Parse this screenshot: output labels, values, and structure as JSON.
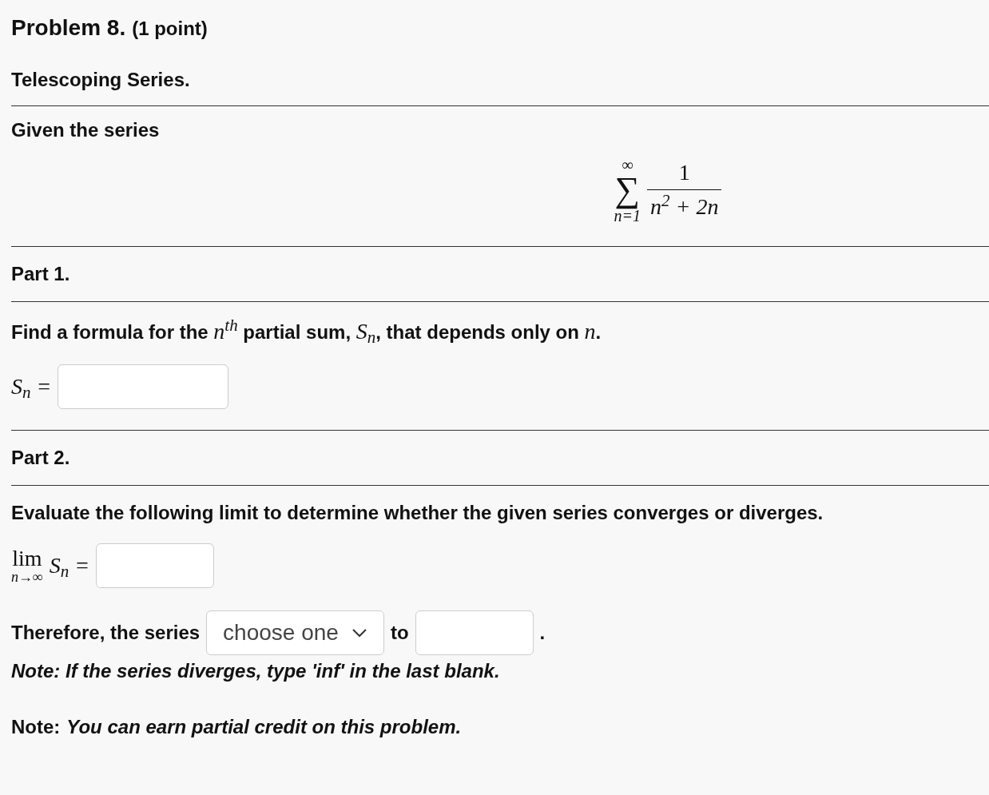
{
  "problem": {
    "title": "Problem 8.",
    "points": "(1 point)"
  },
  "heading": "Telescoping Series.",
  "intro": "Given the series",
  "series": {
    "upper": "∞",
    "sigma": "∑",
    "lower": "n=1",
    "numerator": "1",
    "denominator": "n$^{2}$ + 2n"
  },
  "part1": {
    "title": "Part 1.",
    "prompt": [
      {
        "kind": "text",
        "s": "Find a formula for the "
      },
      {
        "kind": "math",
        "s": "n$^{th}$"
      },
      {
        "kind": "text",
        "s": " partial sum, "
      },
      {
        "kind": "math",
        "s": "S$_{n}$"
      },
      {
        "kind": "text",
        "s": ", that depends only on "
      },
      {
        "kind": "math",
        "s": "n"
      },
      {
        "kind": "text",
        "s": "."
      }
    ],
    "answer_label": "S$_{n}$ ="
  },
  "part2": {
    "title": "Part 2.",
    "prompt": "Evaluate the following limit to determine whether the given series converges or diverges.",
    "limit": {
      "lim": "lim",
      "sub": "n→∞",
      "expr": "S$_{n}$ ="
    },
    "conclusion": {
      "before": "Therefore, the series",
      "dropdown": "choose one",
      "middle": "to",
      "after": "."
    },
    "note": "Note: If the series diverges, type 'inf' in the last blank."
  },
  "footer": {
    "label": "Note:",
    "text": "You can earn partial credit on this problem."
  }
}
